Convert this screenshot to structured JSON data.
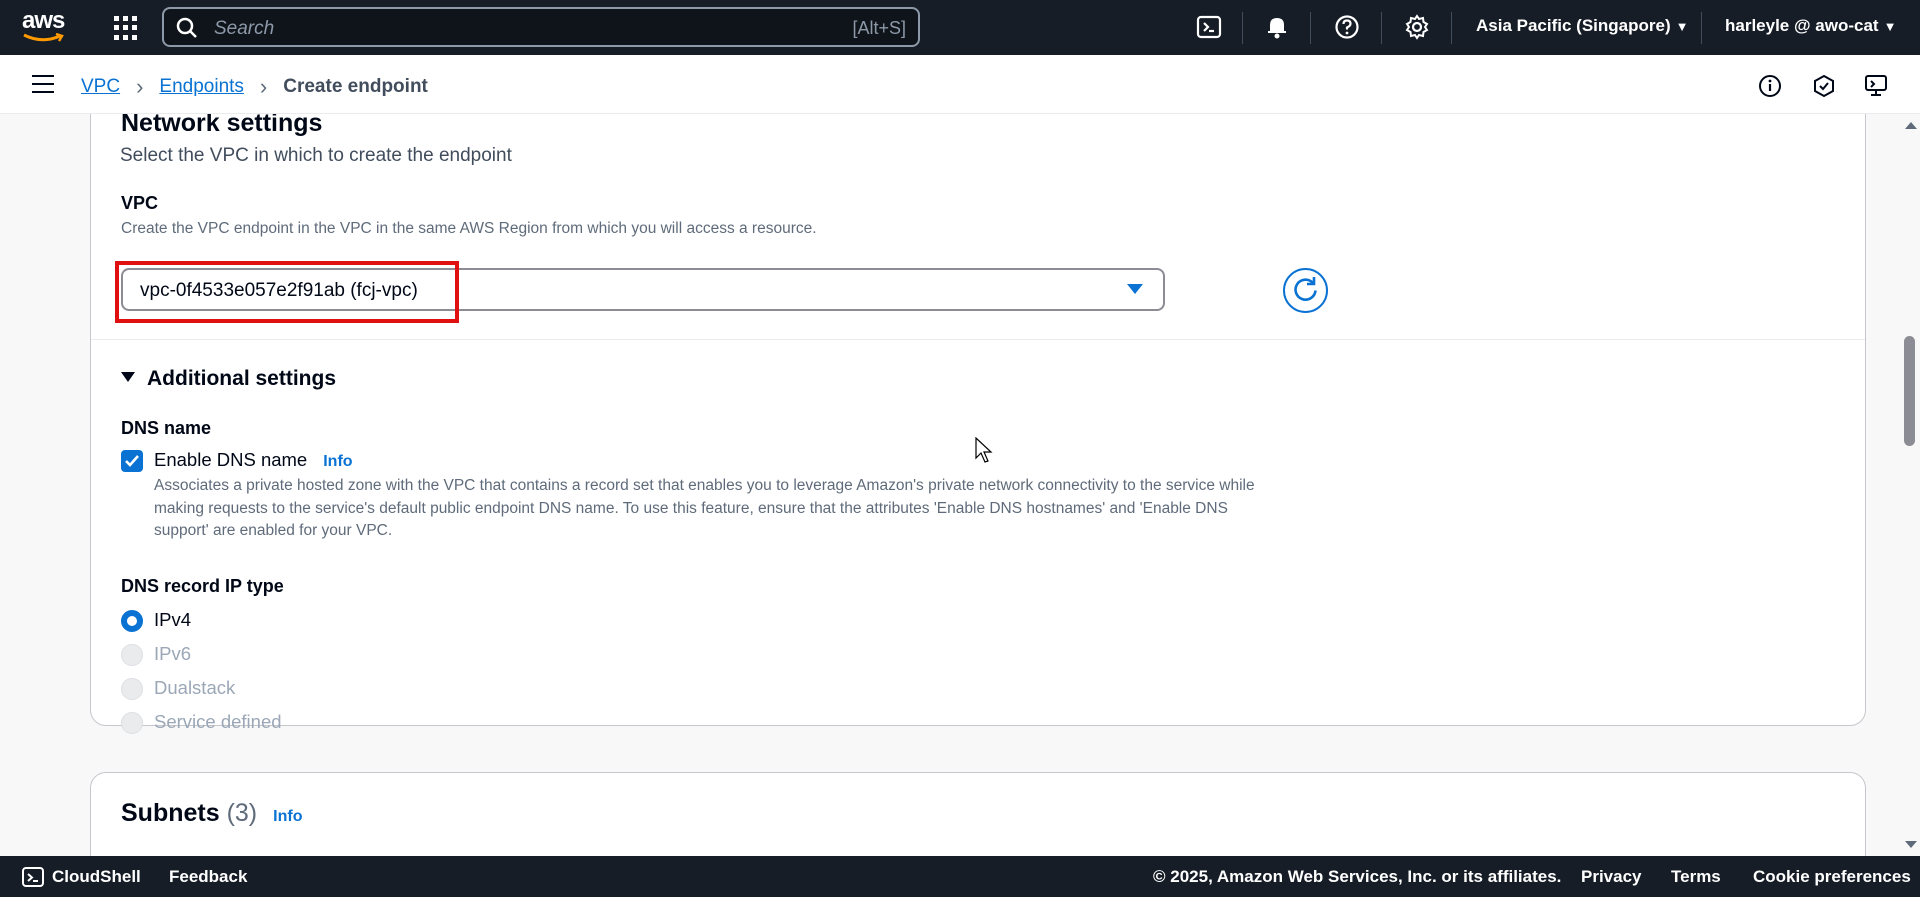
{
  "topbar": {
    "logo_text": "aws",
    "search_placeholder": "Search",
    "search_shortcut": "[Alt+S]",
    "region": "Asia Pacific (Singapore)",
    "user": "harleyle @ awo-cat",
    "icons": [
      "cloudshell-icon",
      "bell-icon",
      "help-icon",
      "gear-icon"
    ]
  },
  "breadcrumb": {
    "items": [
      "VPC",
      "Endpoints"
    ],
    "current": "Create endpoint"
  },
  "network_settings": {
    "title": "Network settings",
    "subtitle": "Select the VPC in which to create the endpoint",
    "vpc_label": "VPC",
    "vpc_description": "Create the VPC endpoint in the VPC in the same AWS Region from which you will access a resource.",
    "vpc_value": "vpc-0f4533e057e2f91ab (fcj-vpc)"
  },
  "additional_settings": {
    "title": "Additional settings",
    "dns_name_label": "DNS name",
    "enable_dns_label": "Enable DNS name",
    "enable_dns_checked": true,
    "info_label": "Info",
    "enable_dns_description": "Associates a private hosted zone with the VPC that contains a record set that enables you to leverage Amazon's private network connectivity to the service while making requests to the service's default public endpoint DNS name. To use this feature, ensure that the attributes 'Enable DNS hostnames' and 'Enable DNS support' are enabled for your VPC.",
    "dns_record_label": "DNS record IP type",
    "ip_options": [
      {
        "label": "IPv4",
        "selected": true,
        "enabled": true
      },
      {
        "label": "IPv6",
        "selected": false,
        "enabled": false
      },
      {
        "label": "Dualstack",
        "selected": false,
        "enabled": false
      },
      {
        "label": "Service defined",
        "selected": false,
        "enabled": false
      }
    ]
  },
  "subnets": {
    "title": "Subnets",
    "count": "(3)",
    "info_label": "Info"
  },
  "footer": {
    "cloudshell": "CloudShell",
    "feedback": "Feedback",
    "copyright": "© 2025, Amazon Web Services, Inc. or its affiliates.",
    "links": [
      "Privacy",
      "Terms",
      "Cookie preferences"
    ]
  },
  "colors": {
    "nav_bg": "#161d26",
    "accent": "#0972d3",
    "highlight": "#e01010"
  }
}
